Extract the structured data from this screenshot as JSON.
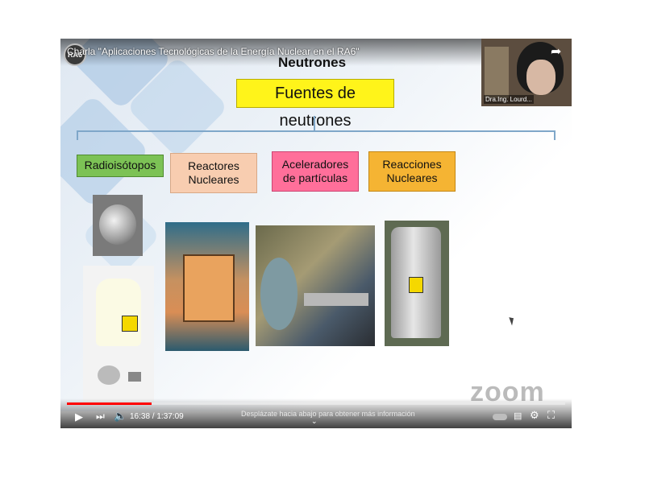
{
  "video": {
    "title": "Charla \"Aplicaciones Tecnológicas de la Energía Nuclear en el RA6\"",
    "logo_text": "RA6"
  },
  "slide": {
    "heading": "Neutrones",
    "main_box": "Fuentes de neutrones",
    "categories": [
      {
        "label": "Radioisótopos",
        "color": "#7cc255"
      },
      {
        "label": "Reactores Nucleares",
        "color": "#f8cdb0"
      },
      {
        "label": "Aceleradores de partículas",
        "color": "#ff6f9a"
      },
      {
        "label": "Reacciones Nucleares",
        "color": "#f5b433"
      }
    ]
  },
  "participant": {
    "name": "Dra.Ing. Lourd..."
  },
  "watermark": "zoom",
  "player": {
    "time": "16:38 / 1:37:09",
    "scroll_hint": "Desplázate hacia abajo para obtener más información",
    "progress": 0.17,
    "accent": "#ff0000"
  }
}
